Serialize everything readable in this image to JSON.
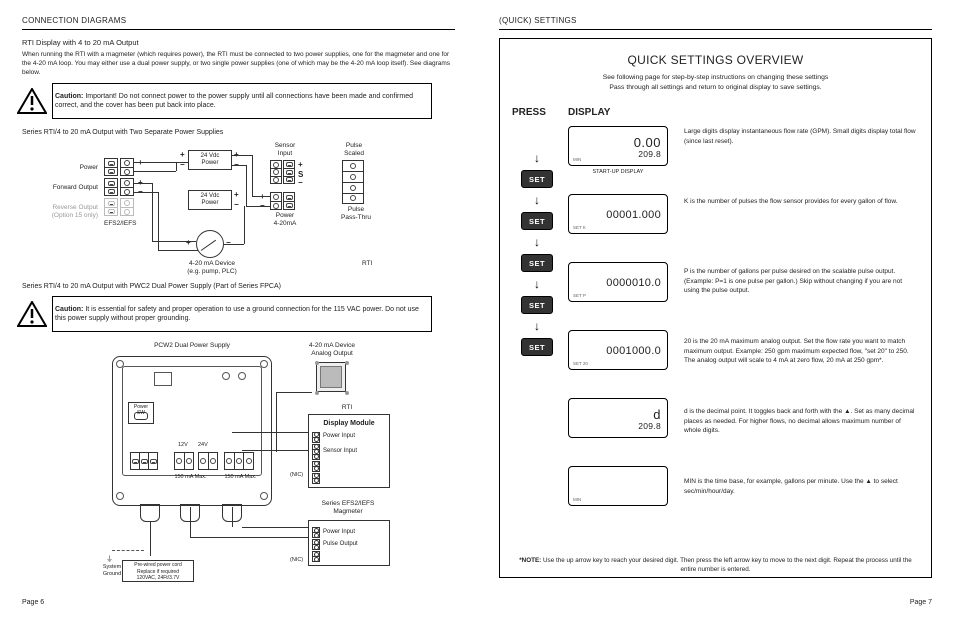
{
  "left": {
    "header": "CONNECTION DIAGRAMS",
    "h1": "RTI Display with 4 to 20 mA Output",
    "intro": "When running the RTI with a magmeter (which requires power), the RTI must be connected to two power supplies, one for the magmeter and one for the 4-20 mA loop. You may either use a dual power supply, or two single power supplies (one of which may be the 4-20 mA loop itself). See diagrams below.",
    "caution1_bold": "Caution:",
    "caution1": " Important! Do not connect power to the power supply until all connections have been made and confirmed correct, and the cover has been put back into place.",
    "sub1": "Series RTI/4 to 20 mA Output with Two Separate Power Supplies",
    "d1": {
      "power": "Power",
      "forward": "Forward Output",
      "reverse1": "Reverse Output",
      "reverse2": "(Option 15 only)",
      "efs": "EFS2/IEFS",
      "v1": "24 Vdc\nPower",
      "v2": "24 Vdc\nPower",
      "sensor": "Sensor\nInput",
      "power420": "Power\n4-20mA",
      "pulseScaled": "Pulse\nScaled",
      "pulsePass": "Pulse\nPass-Thru",
      "device": "4-20 mA Device\n(e.g. pump, PLC)",
      "rti": "RTI"
    },
    "sub2": "Series RTI/4 to 20 mA Output with PWC2 Dual Power Supply (Part of Series FPCA)",
    "caution2_bold": "Caution:",
    "caution2": " It is essential for safety and proper operation to use a ground connection for the 115 VAC power. Do not use this power supply without proper grounding.",
    "d2": {
      "title": "PCW2 Dual Power Supply",
      "analog": "4-20 mA Device\nAnalog Output",
      "rti": "RTI",
      "rti_title": "Display Module",
      "rti_r1": "Power Input",
      "rti_r2": "Sensor Input",
      "rti_nic1": "(NIC)",
      "efs": "Series EFS2/IEFS\nMagmeter",
      "efs_r1": "Power Input",
      "efs_r2": "Pulse Output",
      "efs_nic": "(NIC)",
      "switch": "Power\nSW",
      "v12": "12V",
      "v24": "24V",
      "mmax1": "150 mA Max.",
      "mmax2": "150 mA Max.",
      "cord": "Pre-wired power cord\nReplace if required\n120VAC, 24Ft/3.7V",
      "ground": "System\nGround"
    },
    "pagenum": "Page 6"
  },
  "right": {
    "header": "(QUICK) SETTINGS",
    "title": "QUICK SETTINGS OVERVIEW",
    "sub1": "See following page for step-by-step instructions on changing these settings",
    "sub2": "Pass through all settings and return to original display to save settings.",
    "press": "PRESS",
    "display": "DISPLAY",
    "set": "SET",
    "lcd": [
      {
        "big": "0.00",
        "small": "209.8",
        "corner": "MIN",
        "sub": "START-UP DISPLAY"
      },
      {
        "big": "",
        "small": "00001.000",
        "corner": "SET K",
        "sub": ""
      },
      {
        "big": "",
        "small": "0000010.0",
        "corner": "SET P",
        "sub": ""
      },
      {
        "big": "",
        "small": "0001000.0",
        "corner": "SET 20",
        "sub": ""
      },
      {
        "big": "d",
        "small": "209.8",
        "corner": "",
        "sub": ""
      },
      {
        "big": "",
        "small": "",
        "corner": "MIN",
        "sub": ""
      }
    ],
    "desc": [
      "Large digits display instantaneous flow rate (GPM). Small digits display total flow (since last reset).",
      "K is the number of pulses the flow sensor provides for every gallon of flow.",
      "P is the number of gallons per pulse desired on the scalable pulse output. (Example: P=1 is one pulse per gallon.) Skip without changing if you are not using the pulse output.",
      "20 is the 20 mA maximum analog output. Set the flow rate you want to match maximum output. Example: 250 gpm maximum expected flow, \"set 20\" to 250. The analog output will scale to 4 mA at zero flow, 20 mA at 250 gpm*.",
      "d is the decimal point. It toggles back and forth with the ▲. Set as many decimal places as needed. For higher flows, no decimal allows maximum number of whole digits.",
      "MIN is the time base, for example, gallons per minute. Use the ▲ to select sec/min/hour/day."
    ],
    "note_bold": "*NOTE:",
    "note": " Use the up arrow key to reach your desired digit. Then press the left arrow key to move to the next digit. Repeat the process until the entire number is entered.",
    "pagenum": "Page 7"
  }
}
